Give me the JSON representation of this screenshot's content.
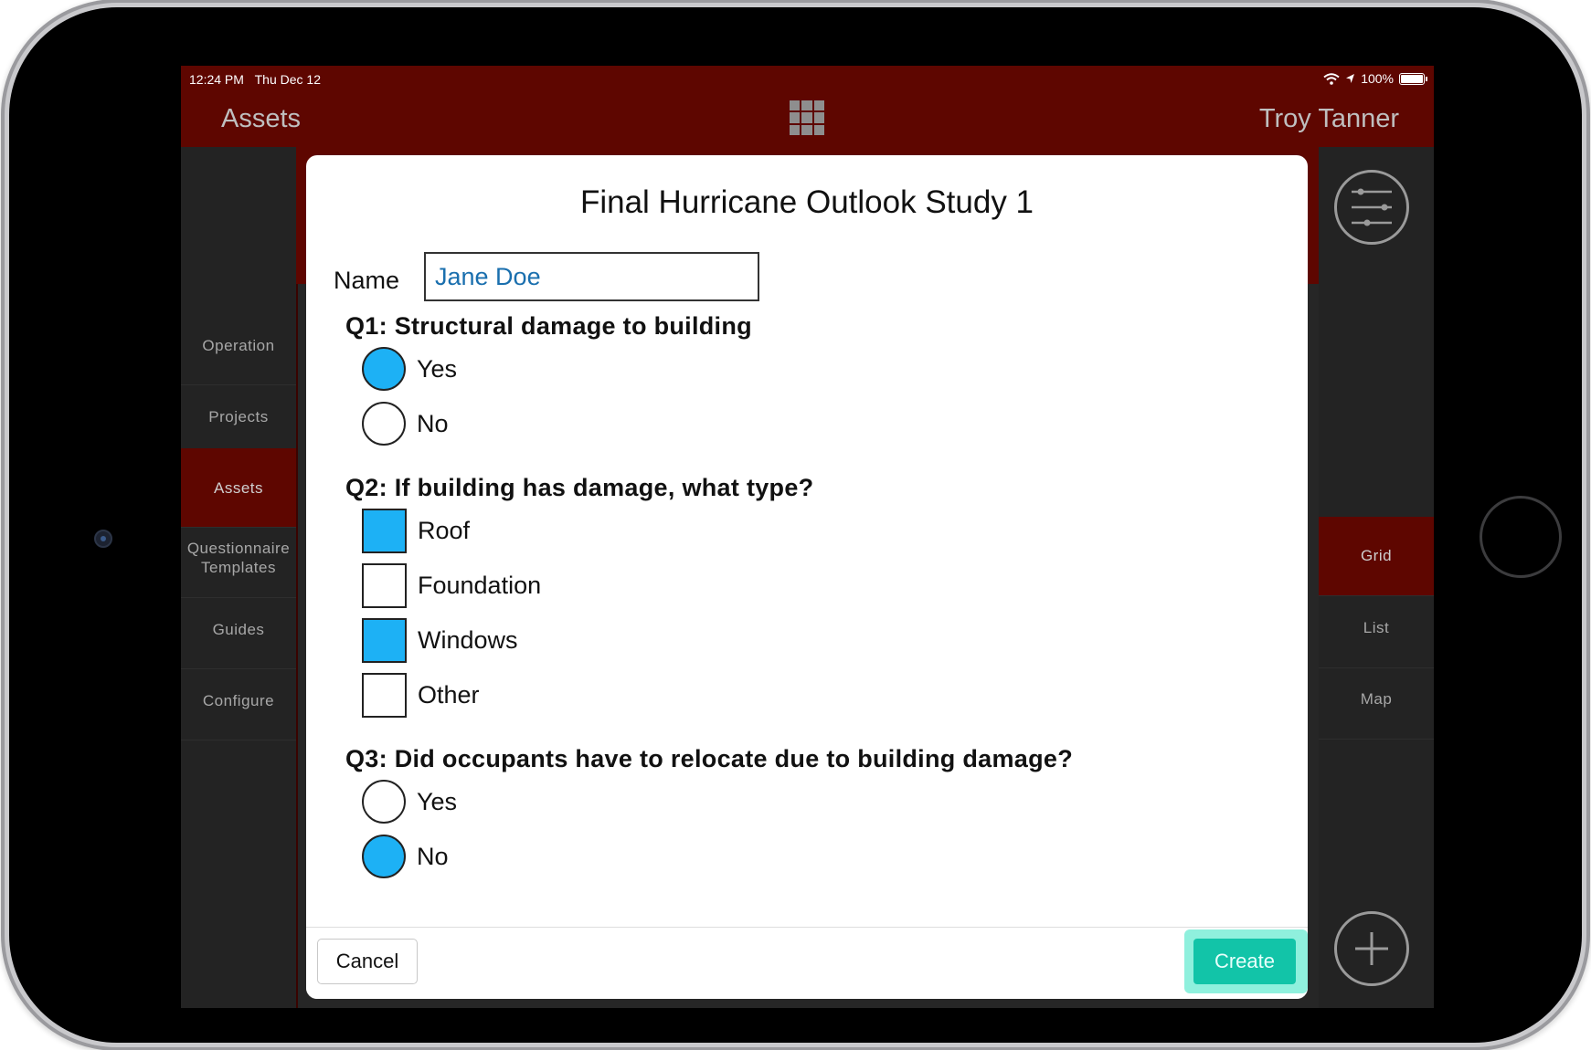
{
  "status_bar": {
    "time": "12:24 PM",
    "date": "Thu Dec 12",
    "battery": "100%",
    "icons": [
      "wifi-icon",
      "location-arrow-icon",
      "battery-icon"
    ]
  },
  "header": {
    "title": "Assets",
    "user": "Troy Tanner",
    "center_icon": "grid-icon"
  },
  "sidebar": {
    "items": [
      {
        "label": "Operation",
        "active": false
      },
      {
        "label": "Projects",
        "active": false
      },
      {
        "label": "Assets",
        "active": true
      },
      {
        "label": "Questionnaire Templates",
        "active": false
      },
      {
        "label": "Guides",
        "active": false
      },
      {
        "label": "Configure",
        "active": false
      }
    ]
  },
  "rightbar": {
    "top_icon": "sliders-icon",
    "views": [
      {
        "label": "Grid",
        "active": true
      },
      {
        "label": "List",
        "active": false
      },
      {
        "label": "Map",
        "active": false
      }
    ],
    "bottom_icon": "plus-icon"
  },
  "modal": {
    "title": "Final Hurricane Outlook Study 1",
    "name_label": "Name",
    "name_value": "Jane Doe",
    "questions": [
      {
        "text": "Q1: Structural damage to building",
        "type": "radio",
        "options": [
          {
            "label": "Yes",
            "selected": true
          },
          {
            "label": "No",
            "selected": false
          }
        ]
      },
      {
        "text": "Q2: If building has damage, what type?",
        "type": "checkbox",
        "options": [
          {
            "label": "Roof",
            "selected": true
          },
          {
            "label": "Foundation",
            "selected": false
          },
          {
            "label": "Windows",
            "selected": true
          },
          {
            "label": "Other",
            "selected": false
          }
        ]
      },
      {
        "text": "Q3: Did occupants have to relocate due to building damage?",
        "type": "radio",
        "options": [
          {
            "label": "Yes",
            "selected": false
          },
          {
            "label": "No",
            "selected": true
          }
        ]
      }
    ],
    "cancel_label": "Cancel",
    "create_label": "Create"
  },
  "colors": {
    "header_bg": "#5e0600",
    "selected_fill": "#1db1f5",
    "create_button": "#12c4a8",
    "sidebar_bg": "#232323"
  }
}
